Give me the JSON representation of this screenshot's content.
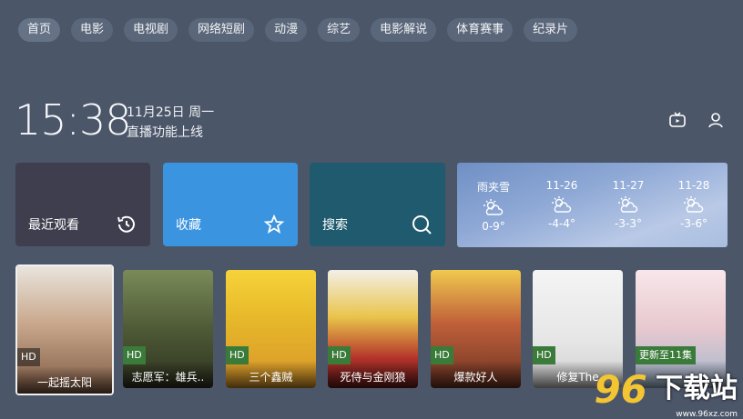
{
  "nav": {
    "tabs": [
      "首页",
      "电影",
      "电视剧",
      "网络短剧",
      "动漫",
      "综艺",
      "电影解说",
      "体育赛事",
      "纪录片"
    ]
  },
  "clock": {
    "time": "15:38",
    "date": "11月25日 周一",
    "subtitle": "直播功能上线"
  },
  "cards": {
    "recent": "最近观看",
    "favorites": "收藏",
    "search": "搜索"
  },
  "weather": [
    {
      "day": "雨夹雪",
      "temp": "0-9°",
      "icon": "cloud-sun-icon"
    },
    {
      "day": "11-26",
      "temp": "-4-4°",
      "icon": "cloud-sun-icon"
    },
    {
      "day": "11-27",
      "temp": "-3-3°",
      "icon": "cloud-sun-icon"
    },
    {
      "day": "11-28",
      "temp": "-3-6°",
      "icon": "cloud-sun-icon"
    }
  ],
  "posters": [
    {
      "title": "一起摇太阳",
      "badge": "HD"
    },
    {
      "title": "志愿军：雄兵..",
      "badge": "HD"
    },
    {
      "title": "三个鑫贼",
      "badge": "HD"
    },
    {
      "title": "死侍与金刚狼",
      "badge": "HD"
    },
    {
      "title": "爆款好人",
      "badge": "HD"
    },
    {
      "title": "修复The",
      "badge": "HD"
    },
    {
      "title": "",
      "badge": "更新至11集"
    }
  ],
  "watermark": {
    "num": "96",
    "text": "下载站",
    "url": "www.96xz.com"
  },
  "colors": {
    "background": "#4b5668",
    "favorites": "#3a94e0",
    "search": "#1f5a6e",
    "recent": "#3e3e4e",
    "accent_watermark": "#f4c533"
  }
}
